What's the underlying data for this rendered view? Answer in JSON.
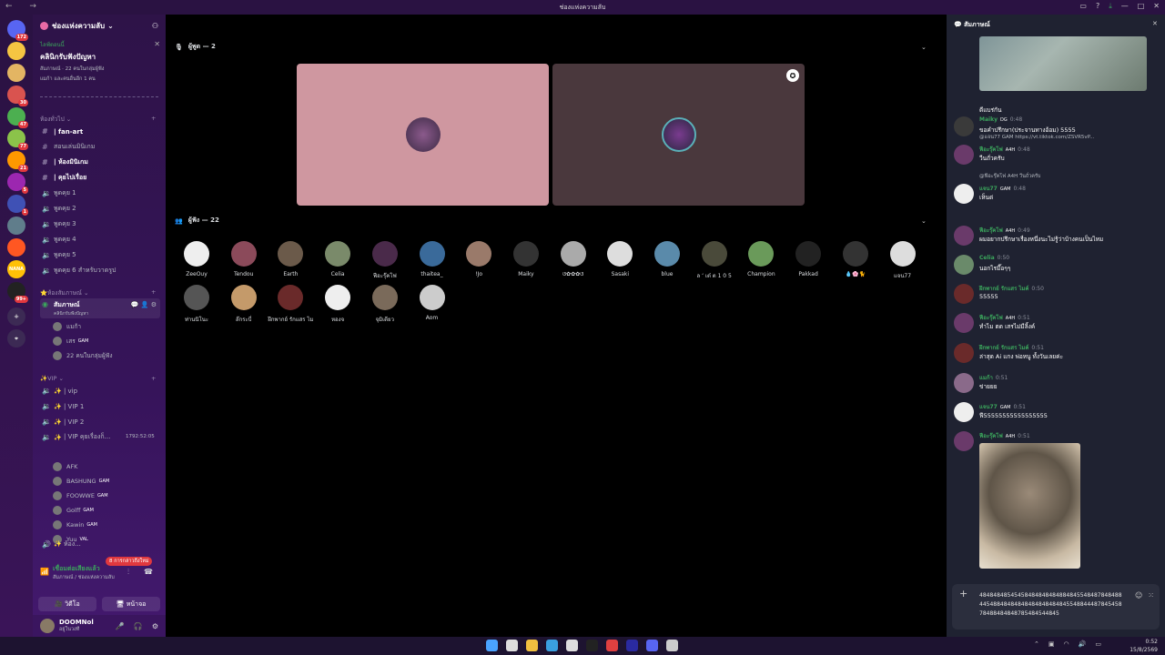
{
  "window": {
    "title": "ช่องแห่งความลับ"
  },
  "server": {
    "name": "ช่องแห่งความลับ"
  },
  "event": {
    "status": "ไลฟ์ตอนนี้",
    "title": "คลินิกรับฟังปัญหา",
    "meta1": "สัมภาษณ์ · 22 คนในกลุ่มผู้ฟัง",
    "meta2": "แมก้า และคนอื่นอีก 1 คน"
  },
  "guilds": [
    {
      "badge": "172",
      "color": "#5865f2"
    },
    {
      "badge": "",
      "color": "#f5c542"
    },
    {
      "badge": "",
      "color": "#e3b563"
    },
    {
      "badge": "30",
      "color": "#d9534f"
    },
    {
      "badge": "47",
      "color": "#4caf50"
    },
    {
      "badge": "77",
      "color": "#8bc34a"
    },
    {
      "badge": "21",
      "color": "#ff9800"
    },
    {
      "badge": "5",
      "color": "#9c27b0"
    },
    {
      "badge": "1",
      "color": "#3f51b5"
    },
    {
      "badge": "",
      "color": "#607d8b"
    },
    {
      "badge": "",
      "color": "#ff5722"
    },
    {
      "badge": "",
      "color": "#ffc107",
      "text": "NANA"
    },
    {
      "badge": "99+",
      "color": "#222"
    }
  ],
  "categories": {
    "general": "ห้องทั่วไป",
    "stage": "ห้องสัมภาษณ์",
    "vip": "✨VIP"
  },
  "channels_text": [
    {
      "label": "| fan-art",
      "bold": true
    },
    {
      "label": "สอนเล่นมินิเกม",
      "bold": false
    },
    {
      "label": "| ห้องมินิเกม",
      "bold": true
    },
    {
      "label": "| คุยไปเรื่อย",
      "bold": true
    }
  ],
  "channels_voice": [
    "พูดคุย 1",
    "พูดคุย 2",
    "พูดคุย 3",
    "พูดคุย 4",
    "พูดคุย 5",
    "พูดคุย 6 สำหรับวาดรูป"
  ],
  "stage_channel": {
    "name": "สัมภาษณ์",
    "sub": "คลินิกรับฟังปัญหา"
  },
  "stage_users": [
    {
      "name": "แมก้า",
      "tag": ""
    },
    {
      "name": "เสร",
      "tag": "GAM"
    },
    {
      "name": "22 คนในกลุ่มผู้ฟัง",
      "tag": ""
    }
  ],
  "vip_channels": [
    "| vip",
    "| VIP 1",
    "| VIP 2",
    "| VIP คุยเรื่องก็..."
  ],
  "vip_timer": "1792:52:05",
  "vip_users": [
    {
      "name": "AFK",
      "tag": ""
    },
    {
      "name": "BASHUNG",
      "tag": "GAM"
    },
    {
      "name": "FOOWWE",
      "tag": "GAM"
    },
    {
      "name": "Golff",
      "tag": "GAM"
    },
    {
      "name": "Kawin",
      "tag": "GAM"
    },
    {
      "name": "Yuu",
      "tag": "VAL"
    }
  ],
  "unread_pill": "8 การกล่าวถึงใหม่",
  "voice_status": {
    "connected": "เชื่อมต่อเสียงแล้ว",
    "location": "สัมภาษณ์ / ช่องแห่งความลับ",
    "video": "วิดีโอ",
    "screen": "หน้าจอ"
  },
  "user": {
    "name": "DOOMNol",
    "status": "อยู่ในวงที"
  },
  "stage": {
    "speakers_label": "ผู้พูด — 2",
    "audience_label": "ผู้ฟัง — 22",
    "tiles": [
      {
        "color": "#cf97a0"
      },
      {
        "color": "#4a383d"
      }
    ],
    "audience": [
      "ZeeOuy",
      "Tendou",
      "Earth",
      "Celia",
      "ฟีอะรุ๊คโฟ",
      "thaitea_",
      "!Jo",
      "Maiky",
      "ଓ✿✿✿ଓ",
      "Sasaki",
      "blue",
      "ล ‘ เต๋ ต 1 0 5",
      "Champion",
      "Pakkad",
      "💧🌸🐈",
      "แจน77",
      "ท่านนิโนะ",
      "ล๊กระบี่",
      "ฝึกพากย์ รักแสร ไมค์",
      "หองจ",
      "จุมิเดียว",
      "Aom"
    ]
  },
  "chat": {
    "title": "สัมภาษณ์",
    "first_text": "ดีแบร่กัน",
    "messages": [
      {
        "user": "Maiky",
        "tag": "DG",
        "time": "0:48",
        "text": "ขอคำปรึกษา(ประจานทางอ้อม) 5555",
        "color": "#3ba55c"
      },
      {
        "reply": "@แจน77 GAM https://vt.tiktok.com/ZSVR5vP...",
        "user": "ฟีอะรุ๊คโฟ",
        "tag": "A4H",
        "time": "0:48",
        "text": "วีนถั่วครับ",
        "color": "#3ba55c"
      },
      {
        "reply": "@ฟีอะรุ๊คโฟ A4H วีนถั่วครับ",
        "user": "แจน77",
        "tag": "GAM",
        "time": "0:48",
        "text": "เห็นด่",
        "color": "#3ba55c"
      },
      {
        "user": "ฟีอะรุ๊คโฟ",
        "tag": "A4H",
        "time": "0:49",
        "text": "ผมอยากปรึกษาเรื่องหนึ่งนะไม่รู้ว่าบ้างคนเป็นไหม",
        "color": "#3ba55c"
      },
      {
        "user": "Celia",
        "tag": "",
        "time": "0:50",
        "text": "นอกไรมี๊อๆๆ",
        "color": "#3ba55c"
      },
      {
        "user": "ฝึกพากย์ รักแสร ไมค์",
        "tag": "",
        "time": "0:50",
        "text": "55555",
        "color": "#3ba55c"
      },
      {
        "user": "ฟีอะรุ๊คโฟ",
        "tag": "A4H",
        "time": "0:51",
        "text": "ทำไม ตด เสรไม่มีลิ้งค์",
        "color": "#3ba55c"
      },
      {
        "user": "ฝึกพากย์ รักแสร ไมค์",
        "tag": "",
        "time": "0:51",
        "text": "ล่าสุด Ai แกง พ่อหนู ทั้งวันเลยค่ะ",
        "color": "#3ba55c"
      },
      {
        "user": "แมก้า",
        "tag": "",
        "time": "0:51",
        "text": "ข่ายยย",
        "color": "#3ba55c"
      },
      {
        "user": "แจน77",
        "tag": "GAM",
        "time": "0:51",
        "text": "ฟี55555555555555555",
        "color": "#3ba55c"
      },
      {
        "user": "ฟีอะรุ๊คโฟ",
        "tag": "A4H",
        "time": "0:51",
        "text": "",
        "color": "#3ba55c"
      }
    ],
    "composer_text": "484848485454584848484848848455484878484884454884848484848484848484554884448784545878488484848785484544845"
  },
  "taskbar": {
    "time": "0:52",
    "date": "15/8/2569"
  }
}
